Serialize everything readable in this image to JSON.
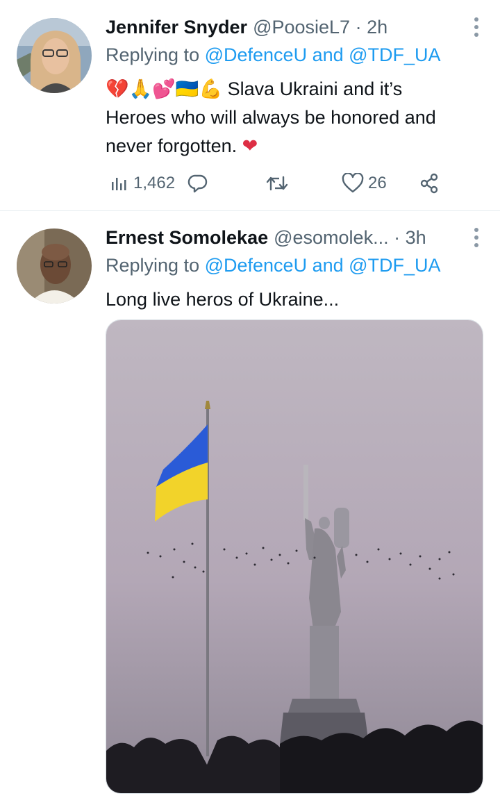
{
  "tweets": [
    {
      "name": "Jennifer Snyder",
      "meta": "@PoosieL7 · 2h",
      "reply_prefix": "Replying to ",
      "reply_user1": "@DefenceU",
      "reply_and": " and ",
      "reply_user2": "@TDF_UA",
      "emoji_prefix": "💔🙏💕🇺🇦💪",
      "text_line1": " Slava Ukraini and it’s",
      "text_line2": "Heroes who will always be honored and",
      "text_line3": "never forgotten. ",
      "text_heart": "❤",
      "views": "1,462",
      "likes": "26"
    },
    {
      "name": "Ernest Somolekae",
      "meta": "@esomolek... · 3h",
      "reply_prefix": "Replying to ",
      "reply_user1": "@DefenceU",
      "reply_and": " and ",
      "reply_user2": "@TDF_UA",
      "text": "Long live heros of Ukraine..."
    }
  ],
  "colors": {
    "link": "#1d9bf0",
    "secondary": "#536471",
    "flag_blue": "#2a5bd7",
    "flag_yellow": "#f2d32a"
  },
  "icons": [
    "views-icon",
    "reply-icon",
    "retweet-icon",
    "like-icon",
    "share-icon",
    "more-icon"
  ]
}
